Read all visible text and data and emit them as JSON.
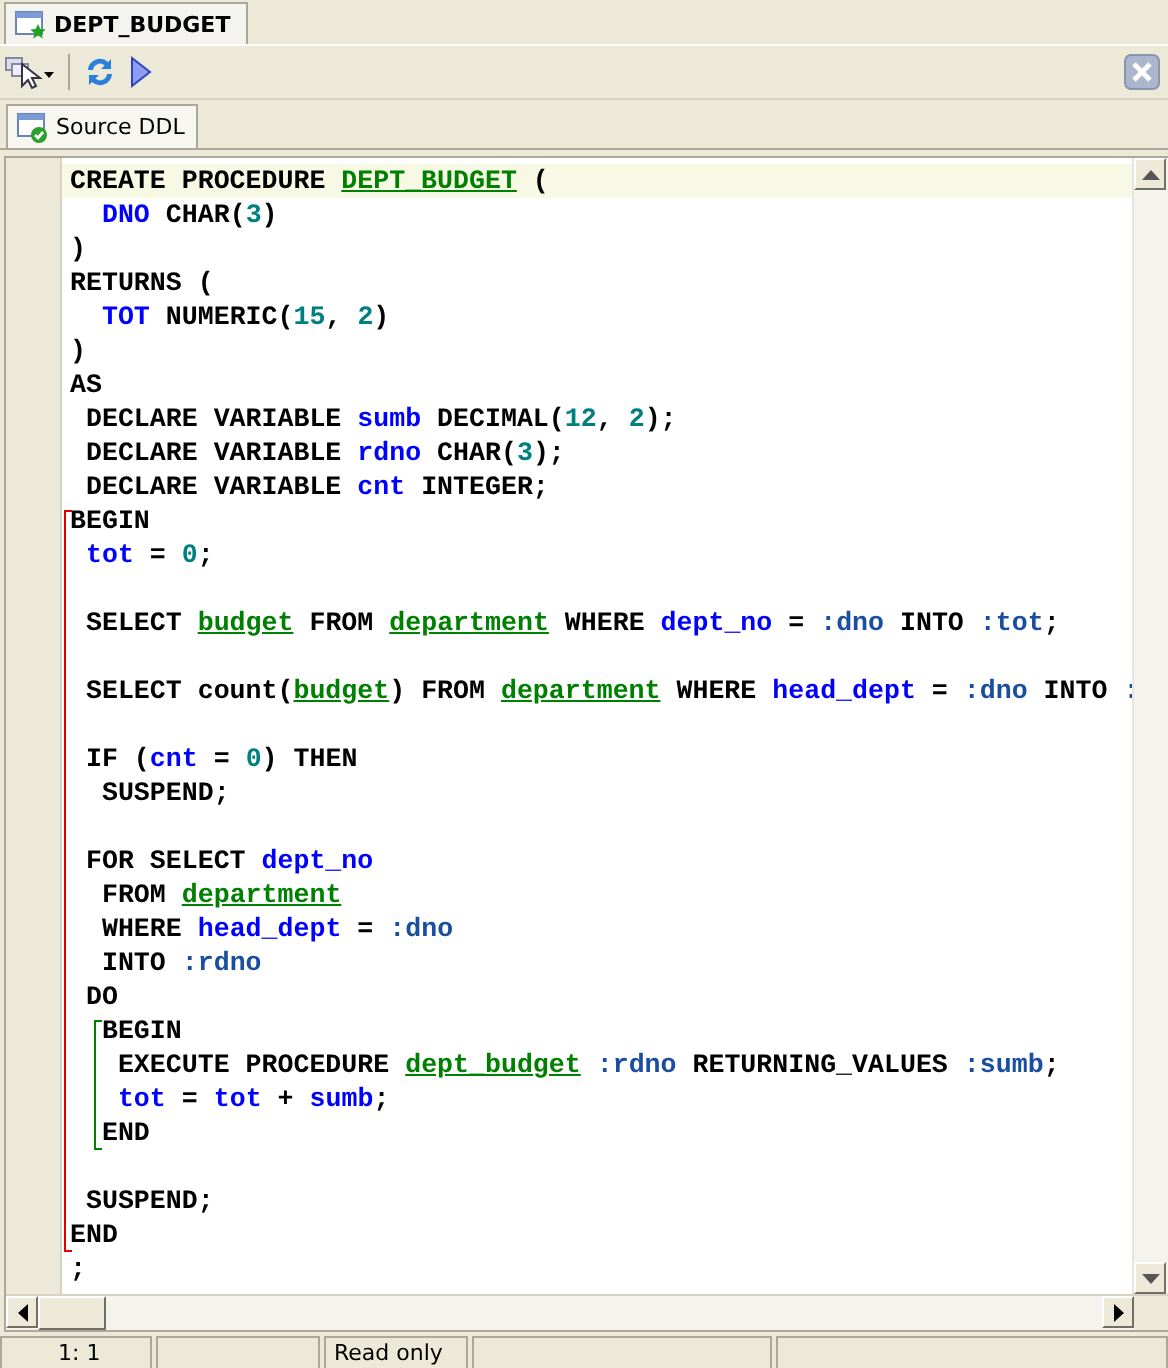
{
  "document_tab": {
    "title": "DEPT_BUDGET",
    "selected": true
  },
  "subtabs": [
    {
      "label": "Source DDL",
      "selected": true
    }
  ],
  "editor": {
    "lines": [
      {
        "current": true,
        "tokens": [
          {
            "kind": "kw",
            "text": "CREATE PROCEDURE "
          },
          {
            "kind": "obj",
            "text": "DEPT_BUDGET"
          },
          {
            "kind": "kw",
            "text": " ("
          }
        ]
      },
      {
        "current": false,
        "tokens": [
          {
            "kind": "id",
            "text": "  DNO"
          },
          {
            "kind": "kw",
            "text": " CHAR("
          },
          {
            "kind": "num",
            "text": "3"
          },
          {
            "kind": "kw",
            "text": ")"
          }
        ]
      },
      {
        "current": false,
        "tokens": [
          {
            "kind": "kw",
            "text": ")"
          }
        ]
      },
      {
        "current": false,
        "tokens": [
          {
            "kind": "kw",
            "text": "RETURNS ("
          }
        ]
      },
      {
        "current": false,
        "tokens": [
          {
            "kind": "id",
            "text": "  TOT"
          },
          {
            "kind": "kw",
            "text": " NUMERIC("
          },
          {
            "kind": "num",
            "text": "15"
          },
          {
            "kind": "kw",
            "text": ", "
          },
          {
            "kind": "num",
            "text": "2"
          },
          {
            "kind": "kw",
            "text": ")"
          }
        ]
      },
      {
        "current": false,
        "tokens": [
          {
            "kind": "kw",
            "text": ")"
          }
        ]
      },
      {
        "current": false,
        "tokens": [
          {
            "kind": "kw",
            "text": "AS"
          }
        ]
      },
      {
        "current": false,
        "tokens": [
          {
            "kind": "kw",
            "text": " DECLARE VARIABLE "
          },
          {
            "kind": "id",
            "text": "sumb"
          },
          {
            "kind": "kw",
            "text": " DECIMAL("
          },
          {
            "kind": "num",
            "text": "12"
          },
          {
            "kind": "kw",
            "text": ", "
          },
          {
            "kind": "num",
            "text": "2"
          },
          {
            "kind": "kw",
            "text": ");"
          }
        ]
      },
      {
        "current": false,
        "tokens": [
          {
            "kind": "kw",
            "text": " DECLARE VARIABLE "
          },
          {
            "kind": "id",
            "text": "rdno"
          },
          {
            "kind": "kw",
            "text": " CHAR("
          },
          {
            "kind": "num",
            "text": "3"
          },
          {
            "kind": "kw",
            "text": ");"
          }
        ]
      },
      {
        "current": false,
        "tokens": [
          {
            "kind": "kw",
            "text": " DECLARE VARIABLE "
          },
          {
            "kind": "id",
            "text": "cnt"
          },
          {
            "kind": "kw",
            "text": " INTEGER;"
          }
        ]
      },
      {
        "children": [
          {
            "current": false,
            "tokens": [
              {
                "kind": "kw",
                "text": "BEGIN"
              }
            ]
          },
          {
            "current": false,
            "tokens": [
              {
                "kind": "id",
                "text": " tot"
              },
              {
                "kind": "kw",
                "text": " = "
              },
              {
                "kind": "num",
                "text": "0"
              },
              {
                "kind": "kw",
                "text": ";"
              }
            ]
          },
          {
            "current": false
          },
          {
            "current": false,
            "tokens": [
              {
                "kind": "kw",
                "text": " SELECT "
              },
              {
                "kind": "obj",
                "text": "budget"
              },
              {
                "kind": "kw",
                "text": " FROM "
              },
              {
                "kind": "obj",
                "text": "department"
              },
              {
                "kind": "kw",
                "text": " WHERE "
              },
              {
                "kind": "id",
                "text": "dept_no"
              },
              {
                "kind": "kw",
                "text": " = "
              },
              {
                "kind": "param",
                "text": ":dno"
              },
              {
                "kind": "kw",
                "text": " INTO "
              },
              {
                "kind": "param",
                "text": ":tot"
              },
              {
                "kind": "kw",
                "text": ";"
              }
            ]
          },
          {
            "current": false
          },
          {
            "current": false,
            "tokens": [
              {
                "kind": "kw",
                "text": " SELECT count("
              },
              {
                "kind": "obj",
                "text": "budget"
              },
              {
                "kind": "kw",
                "text": ") FROM "
              },
              {
                "kind": "obj",
                "text": "department"
              },
              {
                "kind": "kw",
                "text": " WHERE "
              },
              {
                "kind": "id",
                "text": "head_dept"
              },
              {
                "kind": "kw",
                "text": " = "
              },
              {
                "kind": "param",
                "text": ":dno"
              },
              {
                "kind": "kw",
                "text": " INTO "
              },
              {
                "kind": "param",
                "text": ":"
              }
            ]
          },
          {
            "current": false
          },
          {
            "current": false,
            "tokens": [
              {
                "kind": "kw",
                "text": " IF ("
              },
              {
                "kind": "id",
                "text": "cnt"
              },
              {
                "kind": "kw",
                "text": " = "
              },
              {
                "kind": "num",
                "text": "0"
              },
              {
                "kind": "kw",
                "text": ") THEN"
              }
            ]
          },
          {
            "current": false,
            "tokens": [
              {
                "kind": "kw",
                "text": "  SUSPEND;"
              }
            ]
          },
          {
            "current": false
          },
          {
            "current": false,
            "tokens": [
              {
                "kind": "kw",
                "text": " FOR SELECT "
              },
              {
                "kind": "id",
                "text": "dept_no"
              }
            ]
          },
          {
            "current": false,
            "tokens": [
              {
                "kind": "kw",
                "text": "  FROM "
              },
              {
                "kind": "obj",
                "text": "department"
              }
            ]
          },
          {
            "current": false,
            "tokens": [
              {
                "kind": "kw",
                "text": "  WHERE "
              },
              {
                "kind": "id",
                "text": "head_dept"
              },
              {
                "kind": "kw",
                "text": " = "
              },
              {
                "kind": "param",
                "text": ":dno"
              }
            ]
          },
          {
            "current": false,
            "tokens": [
              {
                "kind": "kw",
                "text": "  INTO "
              },
              {
                "kind": "param",
                "text": ":rdno"
              }
            ]
          },
          {
            "current": false,
            "tokens": [
              {
                "kind": "kw",
                "text": " DO"
              }
            ]
          },
          {
            "children": [
              {
                "current": false,
                "tokens": [
                  {
                    "kind": "kw",
                    "text": "  BEGIN"
                  }
                ]
              },
              {
                "current": false,
                "tokens": [
                  {
                    "kind": "kw",
                    "text": "   EXECUTE PROCEDURE "
                  },
                  {
                    "kind": "obj",
                    "text": "dept_budget"
                  },
                  {
                    "kind": "param",
                    "text": " :rdno"
                  },
                  {
                    "kind": "kw",
                    "text": " RETURNING_VALUES "
                  },
                  {
                    "kind": "param",
                    "text": ":sumb"
                  },
                  {
                    "kind": "kw",
                    "text": ";"
                  }
                ]
              },
              {
                "current": false,
                "tokens": [
                  {
                    "kind": "id",
                    "text": "   tot"
                  },
                  {
                    "kind": "kw",
                    "text": " = "
                  },
                  {
                    "kind": "id",
                    "text": "tot"
                  },
                  {
                    "kind": "kw",
                    "text": " + "
                  },
                  {
                    "kind": "id",
                    "text": "sumb"
                  },
                  {
                    "kind": "kw",
                    "text": ";"
                  }
                ]
              },
              {
                "current": false,
                "tokens": [
                  {
                    "kind": "kw",
                    "text": "  END"
                  }
                ]
              }
            ]
          },
          {
            "current": false
          },
          {
            "current": false,
            "tokens": [
              {
                "kind": "kw",
                "text": " SUSPEND;"
              }
            ]
          },
          {
            "current": false,
            "tokens": [
              {
                "kind": "kw",
                "text": "END"
              }
            ]
          }
        ]
      },
      {
        "current": false,
        "tokens": [
          {
            "kind": "kw",
            "text": ";"
          }
        ]
      }
    ]
  },
  "status_bar": {
    "position": "1: 1",
    "mode": "Read only"
  }
}
